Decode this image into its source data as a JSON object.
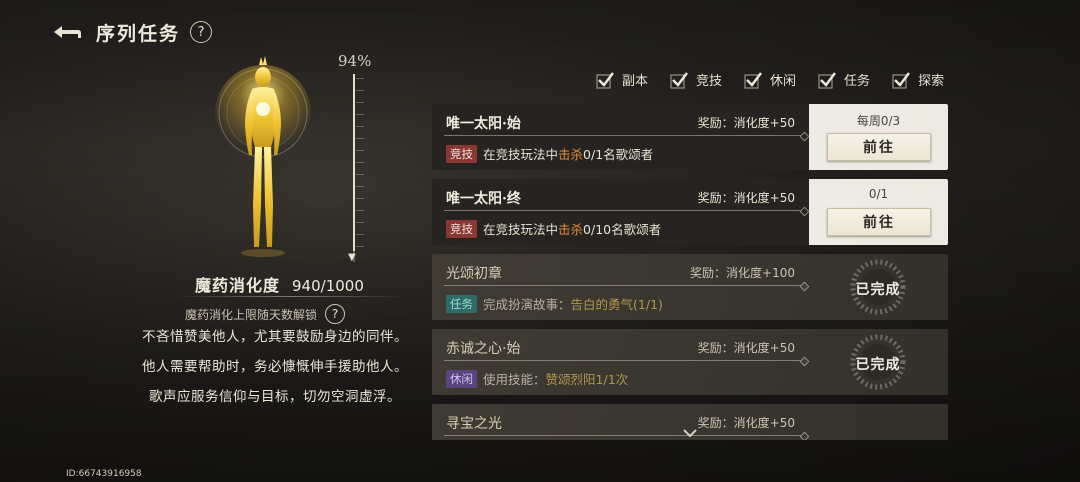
{
  "header": {
    "title": "序列任务",
    "help": "?"
  },
  "progress": {
    "percent_label": "94%",
    "fraction": 0.94
  },
  "digest": {
    "label": "魔药消化度",
    "value": "940/1000"
  },
  "unlock": {
    "text": "魔药消化上限随天数解锁",
    "help": "?"
  },
  "lore": {
    "line1": "不吝惜赞美他人，尤其要鼓励身边的同伴。",
    "line2": "他人需要帮助时，务必慷慨伸手援助他人。",
    "line3": "歌声应服务信仰与目标，切勿空洞虚浮。"
  },
  "filters": [
    {
      "label": "副本",
      "checked": true
    },
    {
      "label": "竞技",
      "checked": true
    },
    {
      "label": "休闲",
      "checked": true
    },
    {
      "label": "任务",
      "checked": true
    },
    {
      "label": "探索",
      "checked": true
    }
  ],
  "tasks": [
    {
      "name": "唯一太阳·始",
      "reward": "奖励：消化度+50",
      "tag": "竞技",
      "desc_pre": "在竞技玩法中",
      "desc_hl": "击杀",
      "desc_post": "0/1名歌颂者",
      "count": "每周0/3",
      "button": "前往"
    },
    {
      "name": "唯一太阳·终",
      "reward": "奖励：消化度+50",
      "tag": "竞技",
      "desc_pre": "在竞技玩法中",
      "desc_hl": "击杀",
      "desc_post": "0/10名歌颂者",
      "count": "0/1",
      "button": "前往"
    },
    {
      "name": "光颂初章",
      "reward": "奖励：消化度+100",
      "tag": "任务",
      "desc_pre": "完成扮演故事：",
      "desc_hl": "告白的勇气",
      "desc_post": "(1/1)",
      "status": "已完成"
    },
    {
      "name": "赤诚之心·始",
      "reward": "奖励：消化度+50",
      "tag": "休闲",
      "desc_pre": "使用技能：",
      "desc_hl": "赞颂烈阳",
      "desc_post": "1/1次",
      "status": "已完成"
    },
    {
      "name": "寻宝之光",
      "reward": "奖励：消化度+50"
    }
  ],
  "uid": "ID:66743916958",
  "colors": {
    "accent": "#e38a3c",
    "gold": "#e8c24a",
    "tag_red": "#8a3632"
  }
}
